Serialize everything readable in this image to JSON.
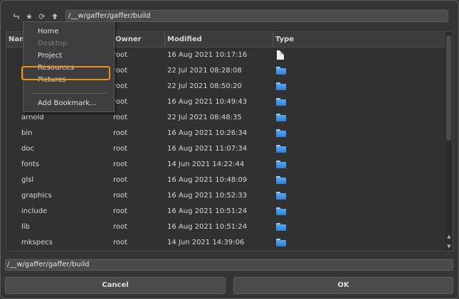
{
  "toolbar": {
    "icons": [
      "branch-icon",
      "star-icon",
      "refresh-icon",
      "up-arrow-icon"
    ],
    "path": "/__w/gaffer/gaffer/build"
  },
  "columns": [
    "Name",
    "Owner",
    "Modified",
    "Type"
  ],
  "rows": [
    {
      "name": "",
      "owner": "root",
      "modified": "16 Aug 2021 10:17:16",
      "type": "file"
    },
    {
      "name": "",
      "owner": "root",
      "modified": "22 Jul 2021 08:28:08",
      "type": "folder"
    },
    {
      "name": "",
      "owner": "root",
      "modified": "22 Jul 2021 08:50:20",
      "type": "folder"
    },
    {
      "name": "",
      "owner": "root",
      "modified": "16 Aug 2021 10:49:43",
      "type": "folder"
    },
    {
      "name": "arnold",
      "owner": "root",
      "modified": "22 Jul 2021 08:48:35",
      "type": "folder"
    },
    {
      "name": "bin",
      "owner": "root",
      "modified": "16 Aug 2021 10:26:34",
      "type": "folder"
    },
    {
      "name": "doc",
      "owner": "root",
      "modified": "16 Aug 2021 11:07:34",
      "type": "folder"
    },
    {
      "name": "fonts",
      "owner": "root",
      "modified": "14 Jun 2021 14:22:44",
      "type": "folder"
    },
    {
      "name": "glsl",
      "owner": "root",
      "modified": "16 Aug 2021 10:48:09",
      "type": "folder"
    },
    {
      "name": "graphics",
      "owner": "root",
      "modified": "16 Aug 2021 10:52:33",
      "type": "folder"
    },
    {
      "name": "include",
      "owner": "root",
      "modified": "16 Aug 2021 10:51:24",
      "type": "folder"
    },
    {
      "name": "lib",
      "owner": "root",
      "modified": "16 Aug 2021 10:51:24",
      "type": "folder"
    },
    {
      "name": "mkspecs",
      "owner": "root",
      "modified": "14 Jun 2021 14:39:06",
      "type": "folder"
    }
  ],
  "menu": {
    "items": [
      {
        "label": "Home",
        "disabled": false
      },
      {
        "label": "Desktop",
        "disabled": true
      },
      {
        "label": "Project",
        "disabled": false
      },
      {
        "label": "Resources",
        "disabled": false
      },
      {
        "label": "Pictures",
        "disabled": false
      }
    ],
    "add_bookmark": "Add Bookmark..."
  },
  "filename": "/__w/gaffer/gaffer/build",
  "buttons": {
    "cancel": "Cancel",
    "ok": "OK"
  },
  "colors": {
    "highlight": "#f0901c",
    "folder": "#3d8fe3"
  }
}
